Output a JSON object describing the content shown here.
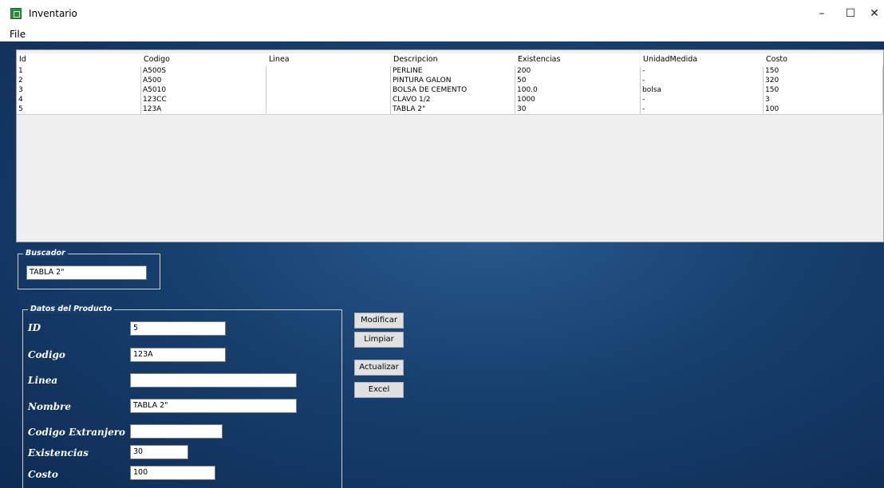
{
  "window": {
    "title": "Inventario",
    "minimize": "–",
    "maximize": "☐",
    "close": "✕"
  },
  "menu": {
    "file": "File"
  },
  "table": {
    "headers": [
      "Id",
      "Codigo",
      "Linea",
      "Descripcion",
      "Existencias",
      "UnidadMedida",
      "Costo"
    ],
    "rows": [
      [
        "1",
        "A500S",
        "",
        "PERLINE",
        "200",
        "-",
        "150"
      ],
      [
        "2",
        "A500",
        "",
        "PINTURA GALON",
        "50",
        "-",
        "320"
      ],
      [
        "3",
        "A5010",
        "",
        "BOLSA DE CEMENTO",
        "100.0",
        "bolsa",
        "150"
      ],
      [
        "4",
        "123CC",
        "",
        "CLAVO 1/2",
        "1000",
        "-",
        "3"
      ],
      [
        "5",
        "123A",
        "",
        "TABLA 2\"",
        "30",
        "-",
        "100"
      ]
    ]
  },
  "buscador": {
    "legend": "Buscador",
    "value": "TABLA 2\""
  },
  "producto": {
    "legend": "Datos del Producto",
    "id_label": "ID",
    "id_value": "5",
    "codigo_label": "Codigo",
    "codigo_value": "123A",
    "linea_label": "Linea",
    "linea_value": "",
    "nombre_label": "Nombre",
    "nombre_value": "TABLA 2\"",
    "extranjero_label": "Codigo Extranjero",
    "extranjero_value": "",
    "existencias_label": "Existencias",
    "existencias_value": "30",
    "costo_label": "Costo",
    "costo_value": "100"
  },
  "buttons": {
    "modificar": "Modificar",
    "limpiar": "Limpiar",
    "actualizar": "Actualizar",
    "excel": "Excel"
  }
}
